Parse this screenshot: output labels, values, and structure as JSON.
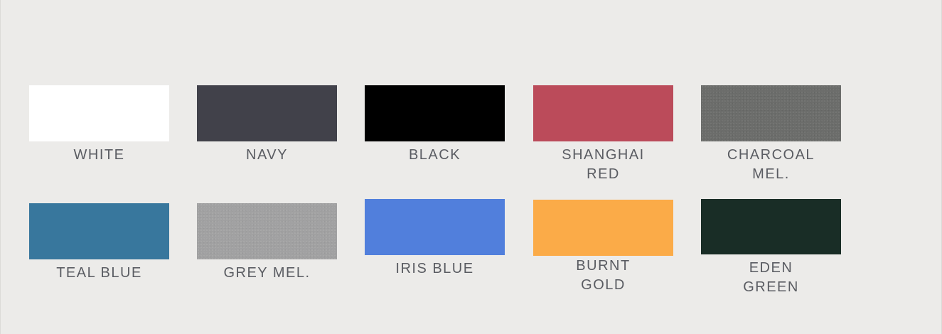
{
  "swatches": [
    {
      "id": "white",
      "color": "#ffffff",
      "label_lines": [
        "WHITE"
      ]
    },
    {
      "id": "navy",
      "color": "#41414a",
      "label_lines": [
        "NAVY"
      ]
    },
    {
      "id": "black",
      "color": "#000000",
      "label_lines": [
        "BLACK"
      ]
    },
    {
      "id": "shanghai-red",
      "color": "#bb4b5a",
      "label_lines": [
        "SHANGHAI",
        "RED"
      ]
    },
    {
      "id": "charcoal-mel",
      "color": "#6c6d6b",
      "label_lines": [
        "CHARCOAL",
        "MEL."
      ]
    },
    {
      "id": "teal-blue",
      "color": "#38779d",
      "label_lines": [
        "TEAL BLUE"
      ]
    },
    {
      "id": "grey-mel",
      "color": "#a1a1a2",
      "label_lines": [
        "GREY MEL."
      ]
    },
    {
      "id": "iris-blue",
      "color": "#517fdc",
      "label_lines": [
        "IRIS BLUE"
      ]
    },
    {
      "id": "burnt-gold",
      "color": "#fbab48",
      "label_lines": [
        "BURNT",
        "GOLD"
      ]
    },
    {
      "id": "eden-green",
      "color": "#192d26",
      "label_lines": [
        "EDEN",
        "GREEN"
      ]
    }
  ]
}
